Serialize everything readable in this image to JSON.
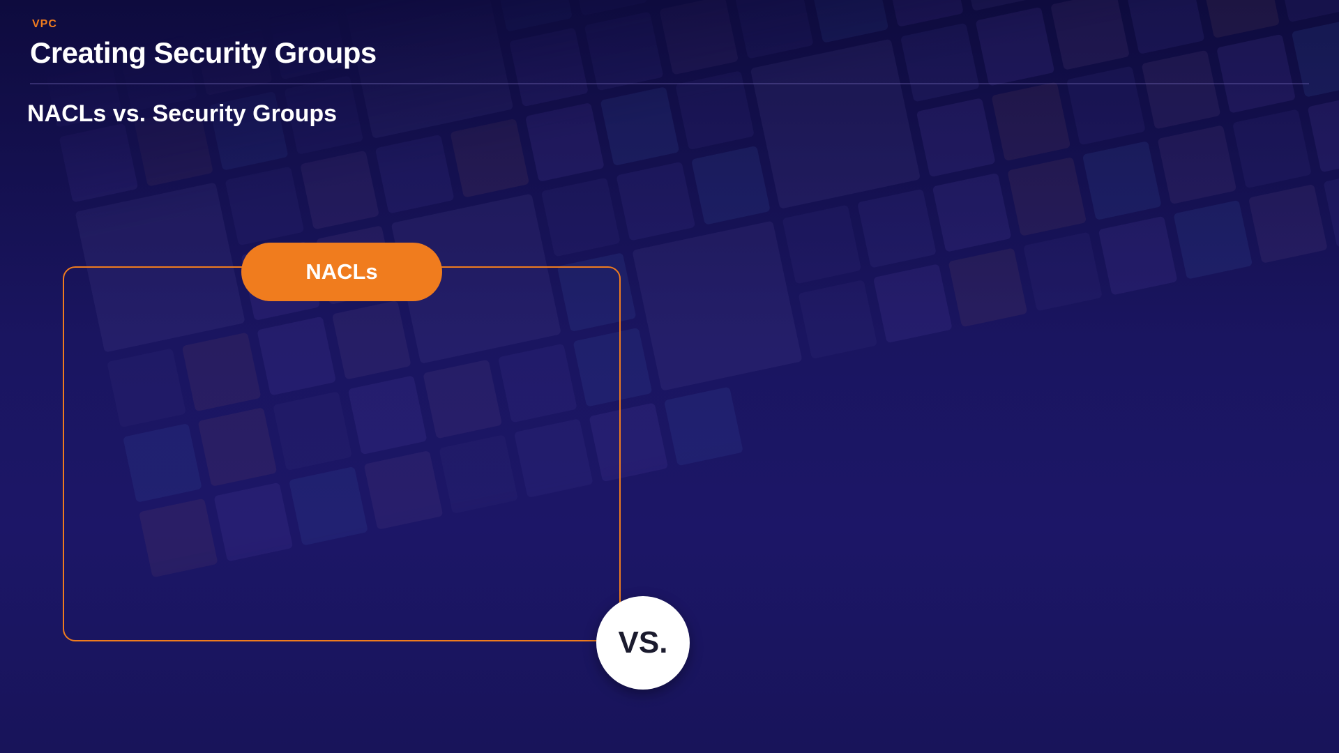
{
  "header": {
    "eyebrow": "VPC",
    "title": "Creating Security Groups"
  },
  "subtitle": "NACLs vs. Security Groups",
  "comparison": {
    "left_label": "NACLs",
    "vs_label": "VS."
  },
  "colors": {
    "accent": "#f07c1e",
    "background": "#1a1560",
    "text": "#ffffff",
    "vs_circle": "#ffffff"
  }
}
